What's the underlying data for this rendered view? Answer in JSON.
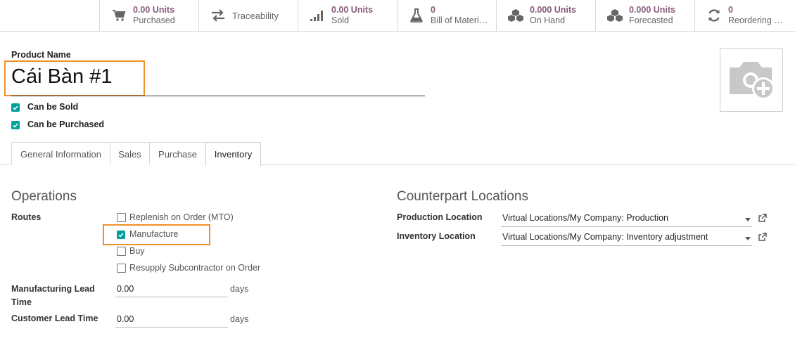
{
  "smart_buttons": [
    {
      "icon": "cart-icon",
      "value": "0.00 Units",
      "label": "Purchased"
    },
    {
      "icon": "exchange-arrows-icon",
      "value": "",
      "label": "Traceability"
    },
    {
      "icon": "signal-bars-icon",
      "value": "0.00 Units",
      "label": "Sold"
    },
    {
      "icon": "flask-icon",
      "value": "0",
      "label": "Bill of Materi…"
    },
    {
      "icon": "cubes-icon",
      "value": "0.000 Units",
      "label": "On Hand"
    },
    {
      "icon": "cubes-icon",
      "value": "0.000 Units",
      "label": "Forecasted"
    },
    {
      "icon": "refresh-icon",
      "value": "0",
      "label": "Reordering R…"
    }
  ],
  "product": {
    "name_label": "Product Name",
    "name": "Cái Bàn #1",
    "can_be_sold_label": "Can be Sold",
    "can_be_sold": true,
    "can_be_purchased_label": "Can be Purchased",
    "can_be_purchased": true
  },
  "tabs": [
    {
      "label": "General Information",
      "active": false
    },
    {
      "label": "Sales",
      "active": false
    },
    {
      "label": "Purchase",
      "active": false
    },
    {
      "label": "Inventory",
      "active": true
    }
  ],
  "operations": {
    "title": "Operations",
    "routes_label": "Routes",
    "routes": [
      {
        "label": "Replenish on Order (MTO)",
        "checked": false
      },
      {
        "label": "Manufacture",
        "checked": true
      },
      {
        "label": "Buy",
        "checked": false
      },
      {
        "label": "Resupply Subcontractor on Order",
        "checked": false
      }
    ],
    "mfg_lead_label_1": "Manufacturing Lead",
    "mfg_lead_label_2": "Time",
    "mfg_lead_value": "0.00",
    "mfg_lead_unit": "days",
    "customer_lead_label": "Customer Lead Time",
    "customer_lead_value": "0.00",
    "customer_lead_unit": "days"
  },
  "counterpart": {
    "title": "Counterpart Locations",
    "production_label": "Production Location",
    "production_value": "Virtual Locations/My Company: Production",
    "inventory_label": "Inventory Location",
    "inventory_value": "Virtual Locations/My Company: Inventory adjustment"
  },
  "colors": {
    "accent": "#875a7b",
    "checkbox": "#00a09d",
    "highlight": "#f0902a"
  }
}
